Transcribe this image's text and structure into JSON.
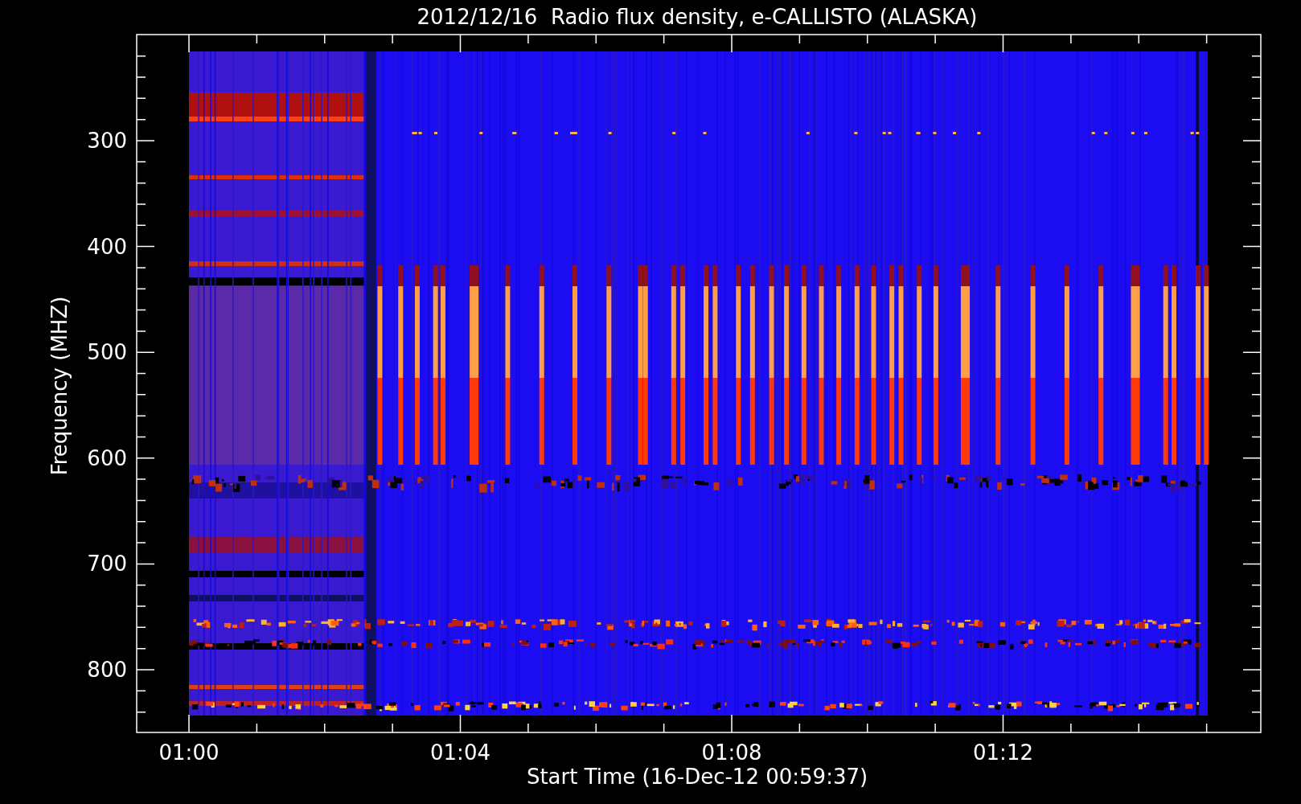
{
  "title": "2012/12/16  Radio flux density, e-CALLISTO (ALASKA)",
  "y_axis": {
    "label": "Frequency (MHZ)",
    "ticks": [
      "300",
      "400",
      "500",
      "600",
      "700",
      "800"
    ]
  },
  "x_axis": {
    "label": "Start Time (16-Dec-12 00:59:37)",
    "ticks": [
      "01:00",
      "01:04",
      "01:08",
      "01:12"
    ]
  }
}
